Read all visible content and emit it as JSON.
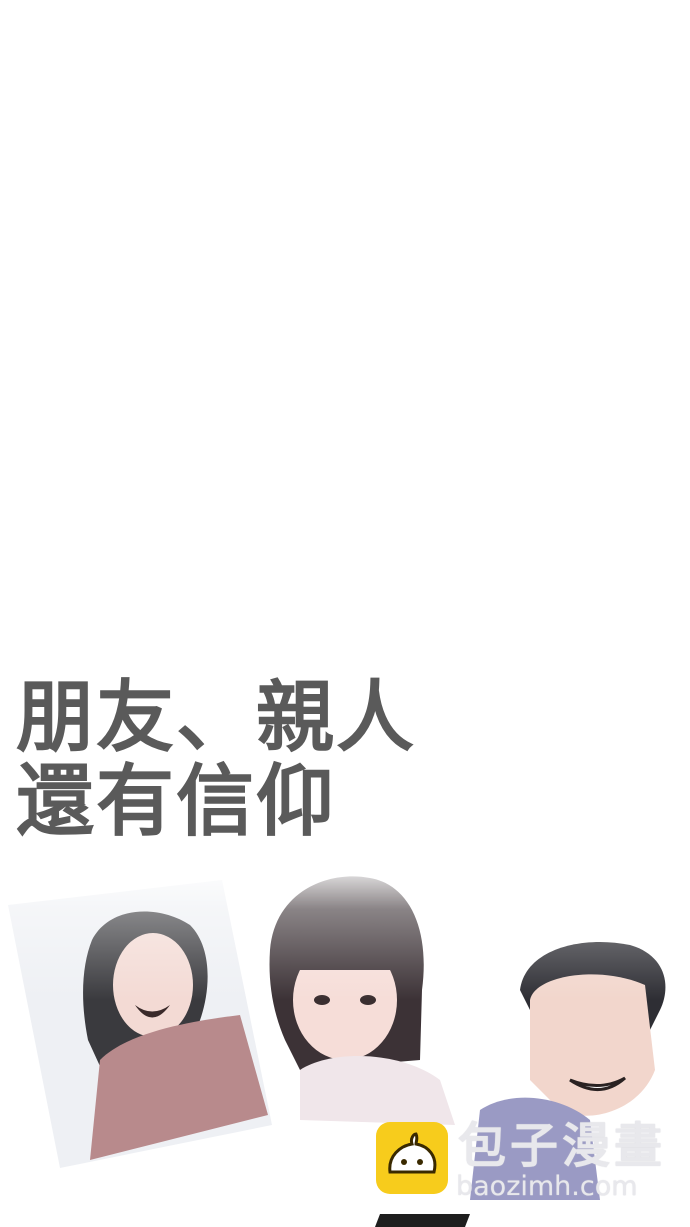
{
  "caption": {
    "line1": "朋友、親人",
    "line2": "還有信仰"
  },
  "watermark": {
    "name": "包子漫畫",
    "url": "baozimh.com",
    "logo_color": "#f7cc1c"
  },
  "colors": {
    "background": "#ffffff",
    "caption_text": "#5a5a5a"
  }
}
